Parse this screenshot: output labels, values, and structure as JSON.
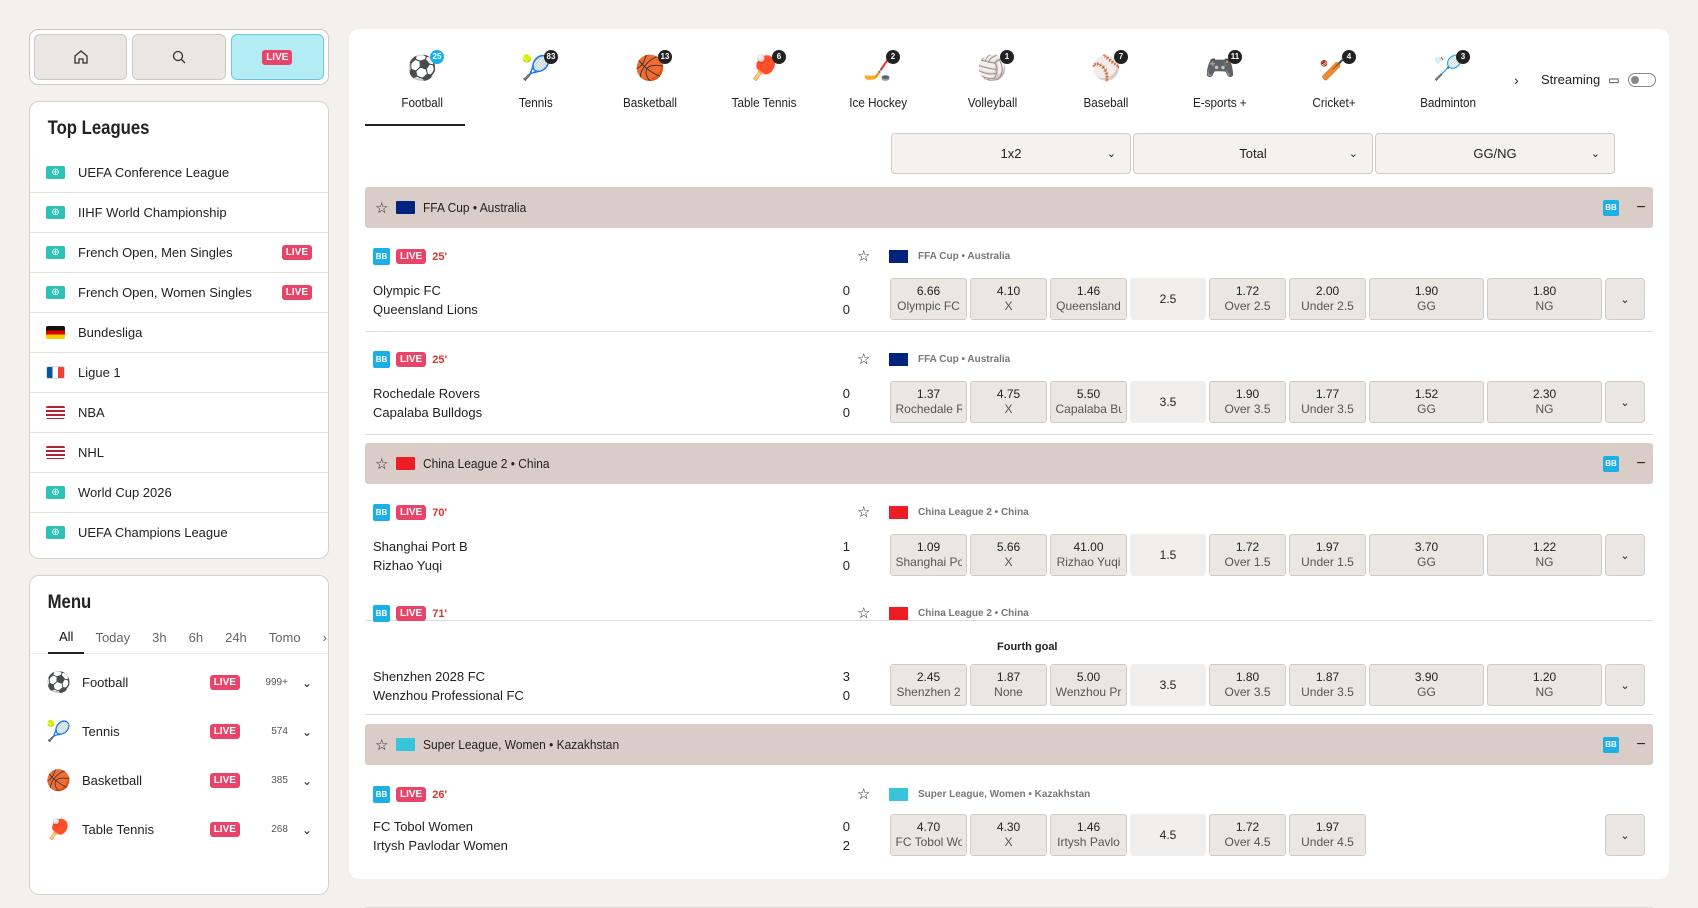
{
  "topbar": {
    "home_icon": "home-icon",
    "search_icon": "search-icon",
    "live_label": "LIVE"
  },
  "top_leagues": {
    "title": "Top Leagues",
    "live_label": "LIVE",
    "items": [
      {
        "label": "UEFA Conference League",
        "icon": "globe",
        "live": false
      },
      {
        "label": "IIHF World Championship",
        "icon": "globe",
        "live": false
      },
      {
        "label": "French Open, Men Singles",
        "icon": "globe",
        "live": true
      },
      {
        "label": "French Open, Women Singles",
        "icon": "globe",
        "live": true
      },
      {
        "label": "Bundesliga",
        "icon": "flag-de",
        "live": false
      },
      {
        "label": "Ligue 1",
        "icon": "flag-fr",
        "live": false
      },
      {
        "label": "NBA",
        "icon": "flag-us",
        "live": false
      },
      {
        "label": "NHL",
        "icon": "flag-us",
        "live": false
      },
      {
        "label": "World Cup 2026",
        "icon": "globe",
        "live": false
      },
      {
        "label": "UEFA Champions League",
        "icon": "globe",
        "live": false
      }
    ]
  },
  "menu": {
    "title": "Menu",
    "tabs": [
      "All",
      "Today",
      "3h",
      "6h",
      "24h",
      "Tomo"
    ],
    "live_label": "LIVE",
    "sports": [
      {
        "label": "Football",
        "count": "999+"
      },
      {
        "label": "Tennis",
        "count": "574"
      },
      {
        "label": "Basketball",
        "count": "385"
      },
      {
        "label": "Table Tennis",
        "count": "268"
      }
    ]
  },
  "sports_tabs": [
    {
      "label": "Football",
      "badge": "25",
      "active": true
    },
    {
      "label": "Tennis",
      "badge": "83"
    },
    {
      "label": "Basketball",
      "badge": "13"
    },
    {
      "label": "Table Tennis",
      "badge": "6"
    },
    {
      "label": "Ice Hockey",
      "badge": "2"
    },
    {
      "label": "Volleyball",
      "badge": "1"
    },
    {
      "label": "Baseball",
      "badge": "7"
    },
    {
      "label": "E-sports +",
      "badge": "11"
    },
    {
      "label": "Cricket+",
      "badge": "4"
    },
    {
      "label": "Badminton",
      "badge": "3"
    }
  ],
  "streaming_label": "Streaming",
  "market_selects": [
    "1x2",
    "Total",
    "GG/NG"
  ],
  "groups": [
    {
      "name": "FFA Cup • Australia",
      "flag": "au"
    },
    {
      "name": "China League 2 • China",
      "flag": "cn"
    },
    {
      "name": "Super League, Women • Kazakhstan",
      "flag": "kz"
    }
  ],
  "bb_label": "BB",
  "live_label": "LIVE",
  "matches": [
    {
      "time": "25'",
      "league": "FFA Cup • Australia",
      "home": "Olympic FC",
      "away": "Queensland Lions",
      "hs": "0",
      "as": "0",
      "odds": [
        [
          "6.66",
          "Olympic FC"
        ],
        [
          "4.10",
          "X"
        ],
        [
          "1.46",
          "Queensland"
        ]
      ],
      "line": "2.5",
      "ou": [
        [
          "1.72",
          "Over 2.5"
        ],
        [
          "2.00",
          "Under 2.5"
        ]
      ],
      "gg": [
        [
          "1.90",
          "GG"
        ],
        [
          "1.80",
          "NG"
        ]
      ]
    },
    {
      "time": "25'",
      "league": "FFA Cup • Australia",
      "home": "Rochedale Rovers",
      "away": "Capalaba Bulldogs",
      "hs": "0",
      "as": "0",
      "odds": [
        [
          "1.37",
          "Rochedale R"
        ],
        [
          "4.75",
          "X"
        ],
        [
          "5.50",
          "Capalaba Bu"
        ]
      ],
      "line": "3.5",
      "ou": [
        [
          "1.90",
          "Over 3.5"
        ],
        [
          "1.77",
          "Under 3.5"
        ]
      ],
      "gg": [
        [
          "1.52",
          "GG"
        ],
        [
          "2.30",
          "NG"
        ]
      ]
    },
    {
      "time": "70'",
      "league": "China League 2 • China",
      "home": "Shanghai Port B",
      "away": "Rizhao Yuqi",
      "hs": "1",
      "as": "0",
      "odds": [
        [
          "1.09",
          "Shanghai Po"
        ],
        [
          "5.66",
          "X"
        ],
        [
          "41.00",
          "Rizhao Yuqi"
        ]
      ],
      "line": "1.5",
      "ou": [
        [
          "1.72",
          "Over 1.5"
        ],
        [
          "1.97",
          "Under 1.5"
        ]
      ],
      "gg": [
        [
          "3.70",
          "GG"
        ],
        [
          "1.22",
          "NG"
        ]
      ]
    },
    {
      "time": "71'",
      "league": "China League 2 • China",
      "home": "Shenzhen 2028 FC",
      "away": "Wenzhou Professional FC",
      "hs": "3",
      "as": "0",
      "note": "Fourth goal",
      "odds": [
        [
          "2.45",
          "Shenzhen 2"
        ],
        [
          "1.87",
          "None"
        ],
        [
          "5.00",
          "Wenzhou Pr"
        ]
      ],
      "line": "3.5",
      "ou": [
        [
          "1.80",
          "Over 3.5"
        ],
        [
          "1.87",
          "Under 3.5"
        ]
      ],
      "gg": [
        [
          "3.90",
          "GG"
        ],
        [
          "1.20",
          "NG"
        ]
      ]
    },
    {
      "time": "26'",
      "league": "Super League, Women • Kazakhstan",
      "home": "FC Tobol Women",
      "away": "Irtysh Pavlodar Women",
      "hs": "0",
      "as": "2",
      "odds": [
        [
          "4.70",
          "FC Tobol Wo"
        ],
        [
          "4.30",
          "X"
        ],
        [
          "1.46",
          "Irtysh Pavlo"
        ]
      ],
      "line": "4.5",
      "ou": [
        [
          "1.72",
          "Over 4.5"
        ],
        [
          "1.97",
          "Under 4.5"
        ]
      ],
      "gg": []
    }
  ]
}
